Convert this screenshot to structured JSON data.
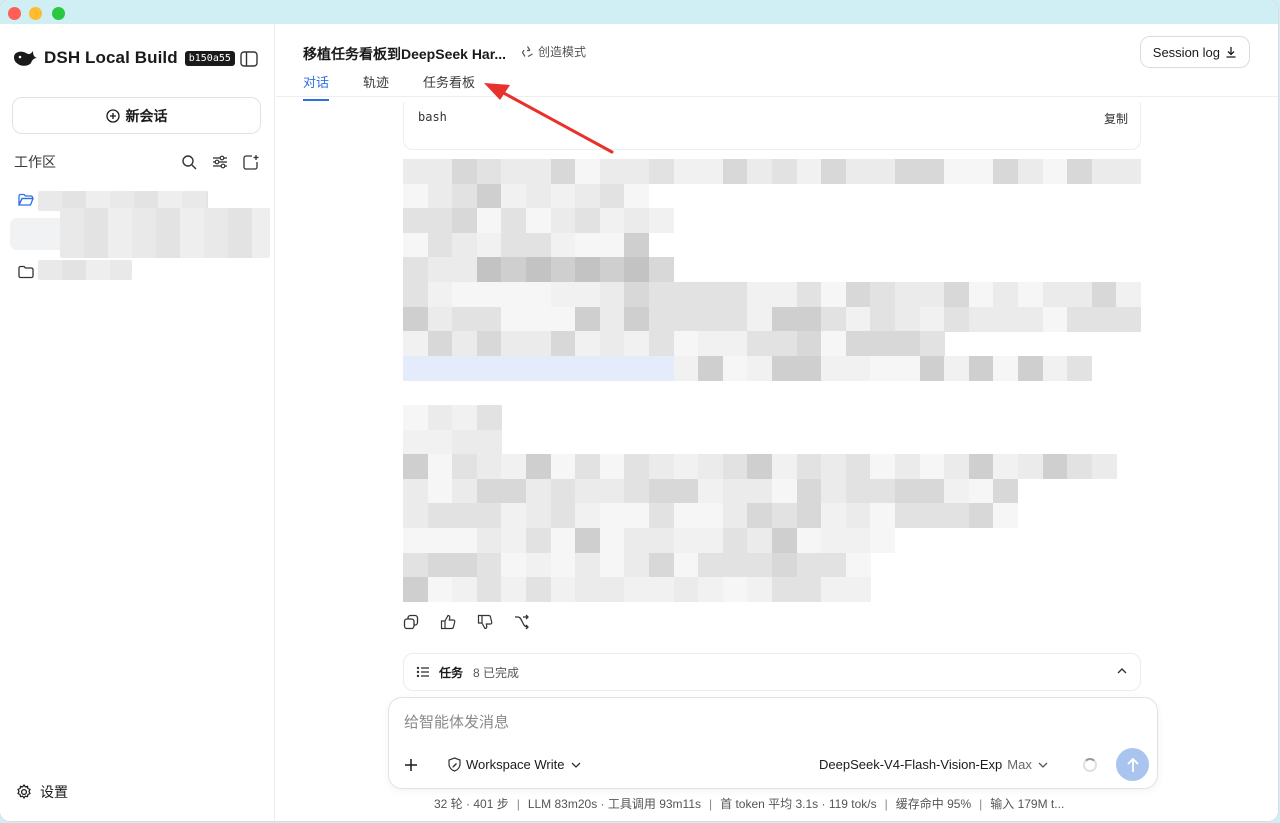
{
  "app": {
    "name": "DSH Local Build",
    "build": "b150a55"
  },
  "sidebar": {
    "new_chat_label": "新会话",
    "workspace_title": "工作区",
    "settings_label": "设置",
    "icons": [
      "search-icon",
      "filter-icon",
      "new-folder-icon"
    ]
  },
  "header": {
    "session_title": "移植任务看板到DeepSeek Har...",
    "mode_label": "创造模式",
    "session_log_label": "Session log",
    "tabs": [
      {
        "label": "对话",
        "active": true
      },
      {
        "label": "轨迹",
        "active": false
      },
      {
        "label": "任务看板",
        "active": false
      }
    ]
  },
  "code_block": {
    "language": "bash",
    "copy_label": "复制"
  },
  "tasks": {
    "label": "任务",
    "status": "8 已完成"
  },
  "composer": {
    "placeholder": "给智能体发消息",
    "permission_label": "Workspace Write",
    "model_name": "DeepSeek-V4-Flash-Vision-Exp",
    "effort": "Max"
  },
  "status": {
    "turns": "32 轮 · 401 步",
    "llm": "LLM 83m20s · 工具调用 93m11s",
    "first_token": "首 token 平均 3.1s · 119 tok/s",
    "cache": "缓存命中 95%",
    "input": "输入 179M t..."
  },
  "colors": {
    "accent": "#2f6fe4",
    "annotation_arrow": "#e8312a",
    "send_button": "#a9c5ef"
  }
}
